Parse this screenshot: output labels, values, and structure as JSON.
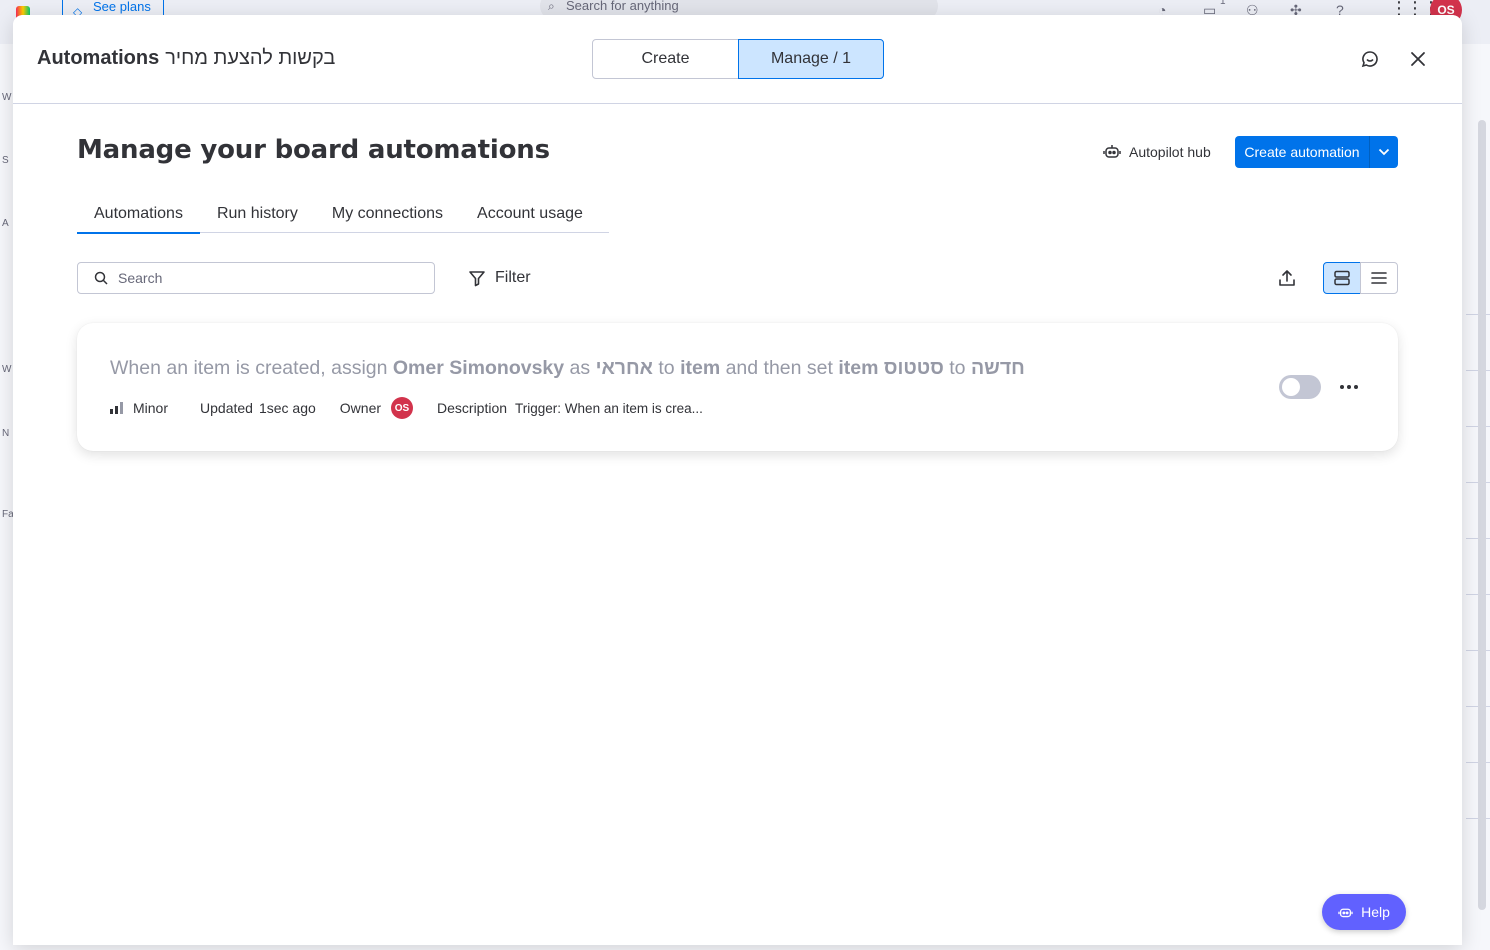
{
  "background": {
    "see_plans": "See plans",
    "search_placeholder": "Search for anything",
    "notification_count": "1",
    "avatar_initials": "OS",
    "sidebar_letters": [
      "W",
      "S",
      "A",
      "W",
      "N",
      "Fa"
    ]
  },
  "modal": {
    "title": "Automations",
    "board_name": "בקשות להצעת מחיר",
    "segments": {
      "create": "Create",
      "manage": "Manage / 1"
    }
  },
  "main": {
    "heading": "Manage your board automations",
    "autopilot_label": "Autopilot hub",
    "create_label": "Create automation",
    "tabs": [
      {
        "label": "Automations"
      },
      {
        "label": "Run history"
      },
      {
        "label": "My connections"
      },
      {
        "label": "Account usage"
      }
    ],
    "search_placeholder": "Search",
    "filter_label": "Filter"
  },
  "automation": {
    "recipe": {
      "p1": "When an item is created, assign ",
      "assignee": "Omer Simonovsky",
      "p2": " as ",
      "column1": "אחראי",
      "p3": " to ",
      "item1": "item",
      "p4": " and then set ",
      "item2": "item",
      "p5": " ",
      "column2": "סטטוס",
      "p6": " to ",
      "value": "חדשה"
    },
    "priority": "Minor",
    "updated_label": "Updated",
    "updated_value": "1sec ago",
    "owner_label": "Owner",
    "owner_initials": "OS",
    "description_label": "Description",
    "description_value": "Trigger: When an item is crea...",
    "enabled": false
  },
  "help_label": "Help",
  "colors": {
    "primary": "#0073ea",
    "selected_bg": "#cce5ff",
    "owner_avatar": "#d2334c",
    "help": "#6161ff"
  }
}
